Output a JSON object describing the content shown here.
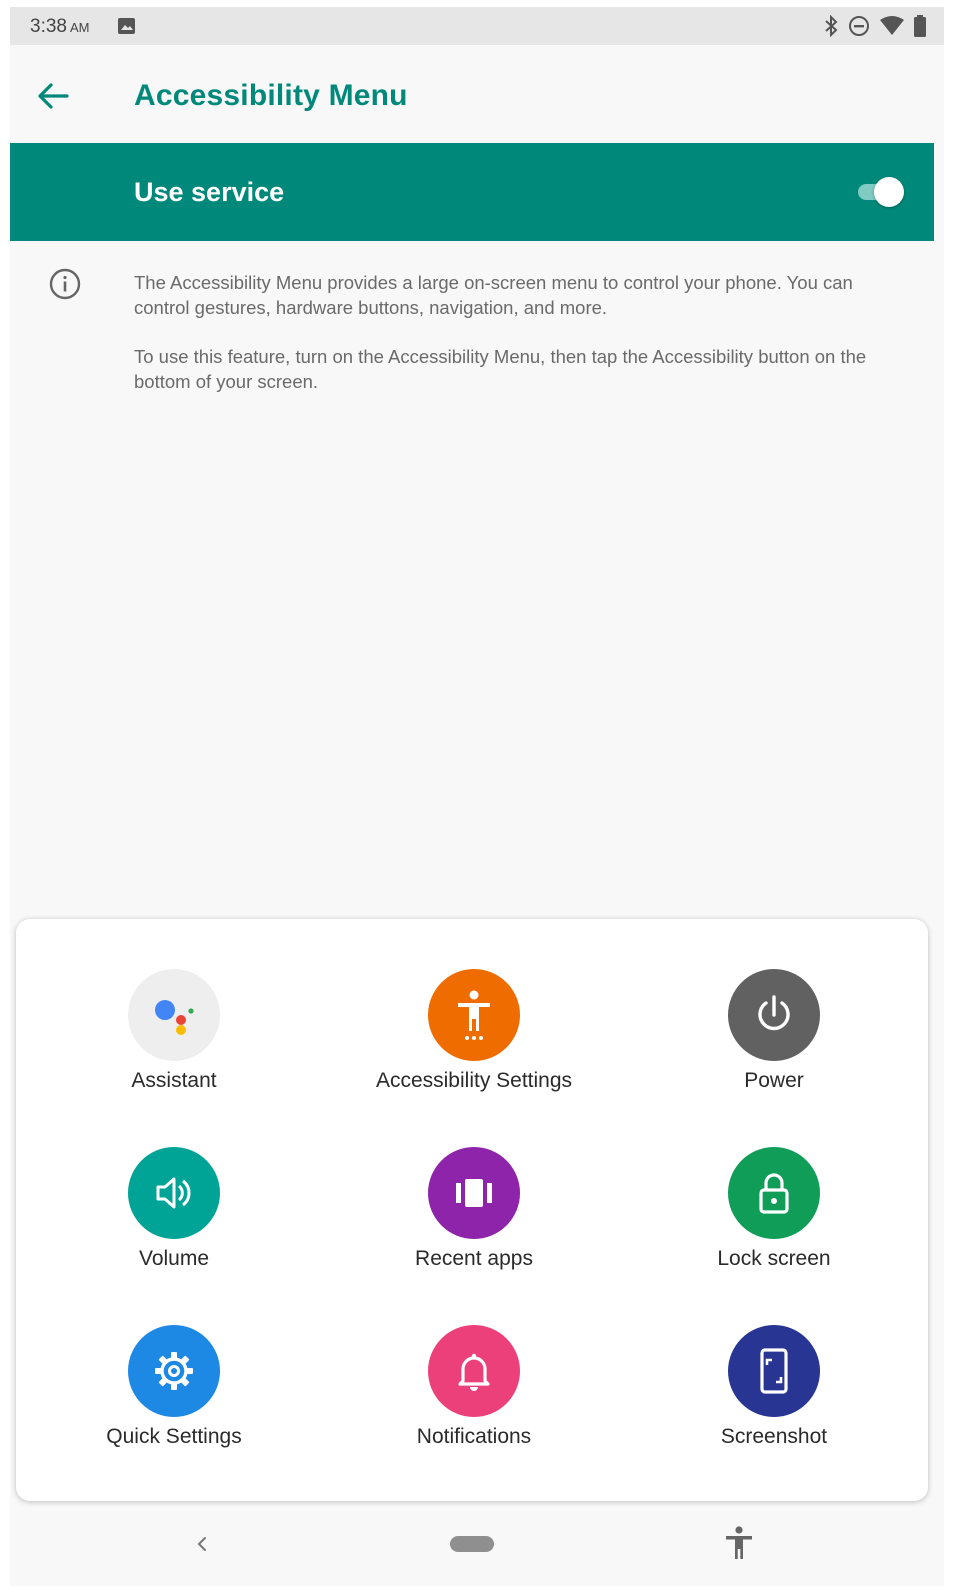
{
  "status_bar": {
    "time": "3:38",
    "ampm": "AM",
    "icons": [
      "image-icon",
      "bluetooth-icon",
      "do-not-disturb-icon",
      "wifi-icon",
      "battery-icon"
    ]
  },
  "app_bar": {
    "title": "Accessibility Menu",
    "back_icon": "arrow-back-icon"
  },
  "use_service": {
    "label": "Use service",
    "enabled": true
  },
  "info": {
    "icon": "info-icon",
    "paragraph_1": "The Accessibility Menu provides a large on-screen menu to control your phone. You can control gestures, hardware buttons, navigation, and more.",
    "paragraph_2": "To use this feature, turn on the Accessibility Menu, then tap the Accessibility button on the bottom of your screen."
  },
  "menu": {
    "items": [
      {
        "label": "Assistant",
        "icon": "assistant-icon",
        "color": "#eeeeee"
      },
      {
        "label": "Accessibility Settings",
        "icon": "accessibility-icon",
        "color": "#ef6c00"
      },
      {
        "label": "Power",
        "icon": "power-icon",
        "color": "#616161"
      },
      {
        "label": "Volume",
        "icon": "volume-icon",
        "color": "#00a497"
      },
      {
        "label": "Recent apps",
        "icon": "recent-apps-icon",
        "color": "#8e24aa"
      },
      {
        "label": "Lock screen",
        "icon": "lock-icon",
        "color": "#0f9d58"
      },
      {
        "label": "Quick Settings",
        "icon": "settings-gear-icon",
        "color": "#1e88e5"
      },
      {
        "label": "Notifications",
        "icon": "bell-icon",
        "color": "#ec407a"
      },
      {
        "label": "Screenshot",
        "icon": "screenshot-icon",
        "color": "#283593"
      }
    ]
  },
  "nav_bar": {
    "icons": [
      "back-chevron-icon",
      "home-pill-icon",
      "accessibility-button-icon"
    ]
  }
}
